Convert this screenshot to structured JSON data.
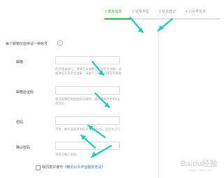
{
  "steps": [
    {
      "label": "1 基本信息",
      "active": true
    },
    {
      "label": "2 选择类型",
      "active": false
    },
    {
      "label": "3 信息登记",
      "active": false
    },
    {
      "label": "4 公众号信息",
      "active": false
    }
  ],
  "form": {
    "section_title": "每个邮箱仅能申请一种帐号",
    "help_icon": "?",
    "email": {
      "label": "邮箱",
      "value": "",
      "hint": "作为登录帐号，请填写未被微信公众平台注册，未被微信开放平台注册，未被个人微信号绑定的邮箱"
    },
    "code": {
      "label": "邮箱验证码",
      "value": "",
      "hint": "激活邮箱后将收到验证邮件，请回填邮件中的6位验证码"
    },
    "password": {
      "label": "密码",
      "value": "",
      "hint": "字母、数字或者英文符号，最短8位，区分大小写"
    },
    "confirm_password": {
      "label": "确认密码",
      "value": "",
      "hint": "请再次输入密码"
    },
    "agreement": {
      "text": "我同意并遵守",
      "link": "《腾讯公众平台服务协议》",
      "checked": false
    }
  },
  "colors": {
    "accent": "#2db34a",
    "arrow": "#20c7c0",
    "link": "#2f73b8"
  },
  "watermark": {
    "brand": "Baidu经验",
    "sub": "jingyan.baidu.com"
  }
}
